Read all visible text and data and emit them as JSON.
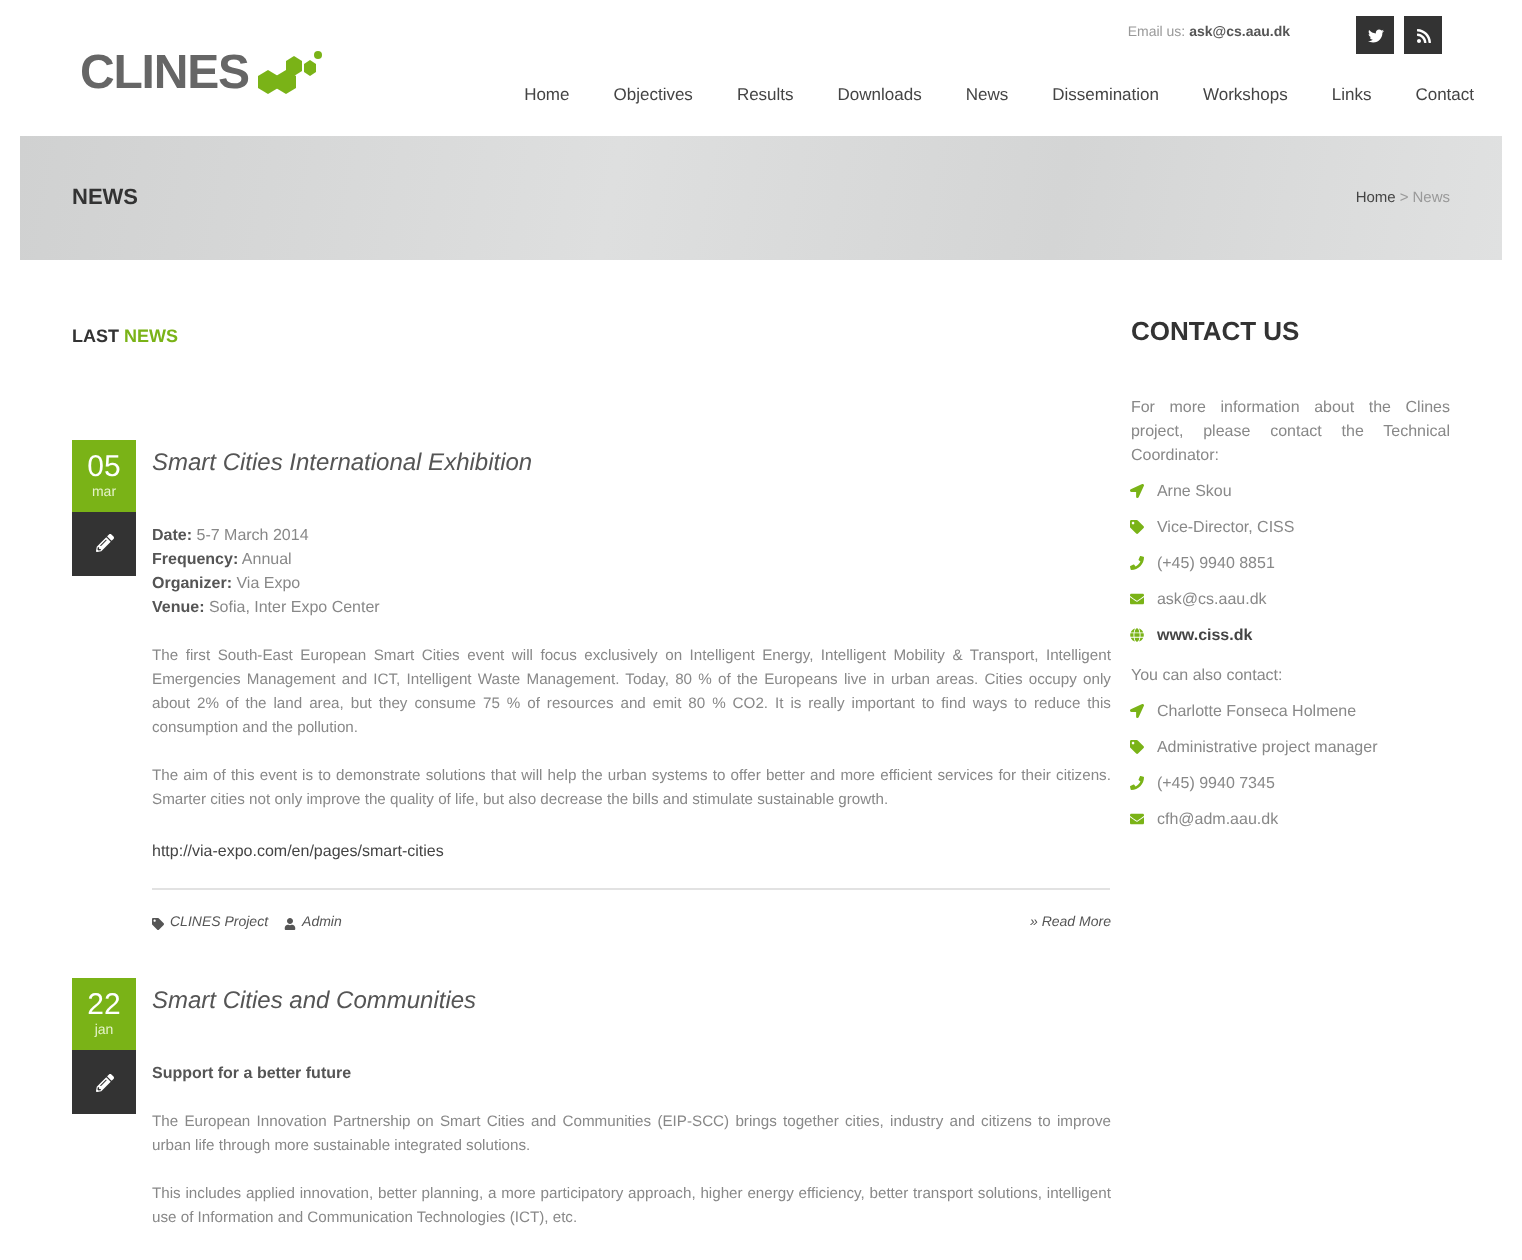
{
  "header": {
    "logo": "CLINES",
    "email_label": "Email us:",
    "email": "ask@cs.aau.dk",
    "social": [
      {
        "kind": "twitter"
      },
      {
        "kind": "rss"
      }
    ],
    "nav": [
      "Home",
      "Objectives",
      "Results",
      "Downloads",
      "News",
      "Dissemination",
      "Workshops",
      "Links",
      "Contact"
    ]
  },
  "banner": {
    "title": "NEWS",
    "breadcrumb": [
      {
        "label": "Home",
        "current": false
      },
      {
        "label": ">",
        "current": true
      },
      {
        "label": "News",
        "current": true
      }
    ]
  },
  "main": {
    "heading_dark": "LAST",
    "heading_accent": "NEWS",
    "articles": [
      {
        "day": "05",
        "month": "mar",
        "title": "Smart Cities International Exhibition",
        "details": [
          "**Date:** 5-7 March 2014",
          "**Frequency:** Annual",
          "**Organizer:** Via Expo",
          "**Venue:** Sofia, Inter Expo Center"
        ],
        "paragraphs": [
          "The first South-East European Smart Cities event will focus exclusively on Intelligent Energy, Intelligent Mobility & Transport, Intelligent Emergencies Management and ICT, Intelligent Waste Management. Today, 80 % of the Europeans live in urban areas. Cities occupy only about 2% of the land area, but they consume 75 % of resources and emit 80 % CO2. It is really important to find ways to reduce this consumption and the pollution.",
          "The aim of this event is to demonstrate solutions that will help the urban systems to offer better and more efficient services for their citizens. Smarter cities not only improve the quality of life, but also decrease the bills and stimulate sustainable growth."
        ],
        "link": "http://via-expo.com/en/pages/smart-cities",
        "category": "CLINES Project",
        "author": "Admin",
        "read_more": "» Read More"
      },
      {
        "day": "22",
        "month": "jan",
        "title": "Smart Cities and Communities",
        "details": [
          "**Support for a better future**"
        ],
        "paragraphs": [
          "The European Innovation Partnership on Smart Cities and Communities (EIP-SCC) brings together cities, industry and citizens to improve urban life through more sustainable integrated solutions.",
          "This includes applied innovation, better planning, a more participatory approach, higher energy efficiency, better transport solutions, intelligent use of Information and Communication Technologies (ICT), etc."
        ]
      }
    ]
  },
  "sidebar": {
    "title": "CONTACT US",
    "intro": "For more information about the Clines project, please contact the Technical Coordinator:",
    "contacts": [
      {
        "kind": "person",
        "text": "Arne Skou"
      },
      {
        "kind": "role",
        "text": "Vice-Director, CISS"
      },
      {
        "kind": "phone",
        "text": "(+45) 9940 8851"
      },
      {
        "kind": "email",
        "text": "ask@cs.aau.dk"
      },
      {
        "kind": "web",
        "text": "www.ciss.dk"
      }
    ],
    "also": "You can also contact:",
    "contacts2": [
      {
        "kind": "person",
        "text": "Charlotte Fonseca Holmene"
      },
      {
        "kind": "role",
        "text": "Administrative project manager"
      },
      {
        "kind": "phone",
        "text": "(+45) 9940 7345"
      },
      {
        "kind": "email",
        "text": "cfh@adm.aau.dk"
      }
    ]
  }
}
